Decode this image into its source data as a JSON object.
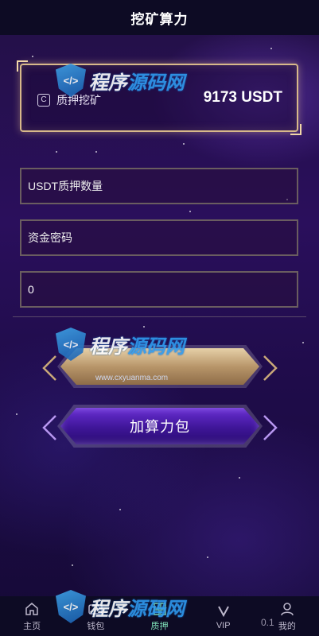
{
  "header": {
    "title": "挖矿算力"
  },
  "stake": {
    "label": "质押挖矿",
    "value": "9173 USDT",
    "icon": "coin-icon"
  },
  "form": {
    "amount_placeholder": "USDT质押数量",
    "password_placeholder": "资金密码",
    "computing_value": "0"
  },
  "buttons": {
    "submit_label": "",
    "add_power_label": "加算力包"
  },
  "tabbar": {
    "items": [
      {
        "label": "主页",
        "icon": "home-icon"
      },
      {
        "label": "钱包",
        "icon": "wallet-icon"
      },
      {
        "label": "质押",
        "icon": "grid-icon",
        "active": true
      },
      {
        "label": "VIP",
        "icon": "vip-icon"
      },
      {
        "label": "我的",
        "icon": "user-icon"
      }
    ]
  },
  "watermark": {
    "text_a": "程序",
    "text_b": "源码网",
    "url": "www.cxyuanma.com"
  },
  "overlay": {
    "timer": "0.1"
  }
}
